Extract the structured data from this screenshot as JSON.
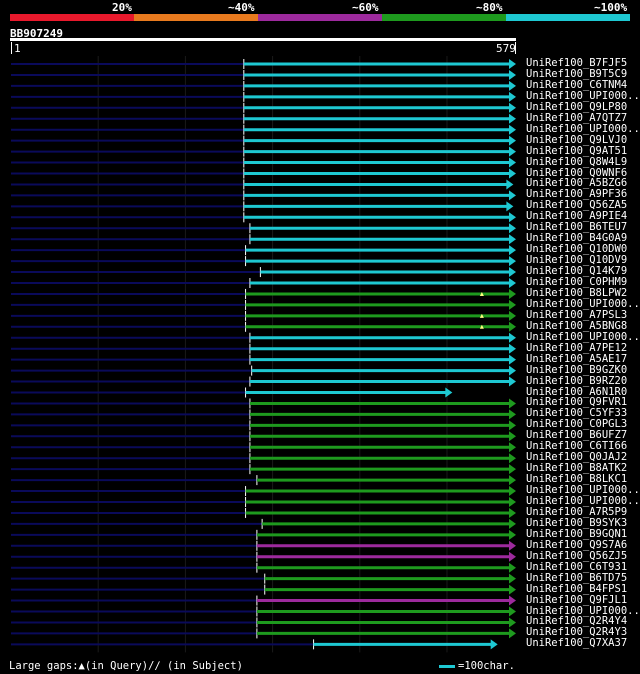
{
  "header": {
    "percent_labels": [
      "20%",
      "~40%",
      "~60%",
      "~80%",
      "~100%"
    ],
    "legend_colors": [
      "#e8192c",
      "#e87a1e",
      "#9d2a9d",
      "#1e9a1e",
      "#1ec8d2"
    ]
  },
  "query": {
    "title": "BB907249",
    "start_label": "1",
    "end_label": "579"
  },
  "colors": {
    "cyan": "#1ec8d2",
    "green": "#1e9a1e",
    "purple": "#9d2a9d",
    "navy": "#0a0a5a",
    "grid": "#1a1a1a",
    "gap_marker": "#ffff80"
  },
  "hits": [
    {
      "label": "UniRef100_B7FJF5",
      "color": "cyan",
      "start": 268,
      "end": 579
    },
    {
      "label": "UniRef100_B9T5C9",
      "color": "cyan",
      "start": 268,
      "end": 579
    },
    {
      "label": "UniRef100_C6TNM4",
      "color": "cyan",
      "start": 268,
      "end": 579
    },
    {
      "label": "UniRef100_UPI000..",
      "color": "cyan",
      "start": 268,
      "end": 579
    },
    {
      "label": "UniRef100_Q9LP80",
      "color": "cyan",
      "start": 268,
      "end": 579
    },
    {
      "label": "UniRef100_A7QTZ7",
      "color": "cyan",
      "start": 268,
      "end": 579
    },
    {
      "label": "UniRef100_UPI000..",
      "color": "cyan",
      "start": 268,
      "end": 579
    },
    {
      "label": "UniRef100_Q9LVJ0",
      "color": "cyan",
      "start": 268,
      "end": 579
    },
    {
      "label": "UniRef100_Q9AT51",
      "color": "cyan",
      "start": 268,
      "end": 579
    },
    {
      "label": "UniRef100_Q8W4L9",
      "color": "cyan",
      "start": 268,
      "end": 579
    },
    {
      "label": "UniRef100_Q0WNF6",
      "color": "cyan",
      "start": 268,
      "end": 579
    },
    {
      "label": "UniRef100_A5BZG6",
      "color": "cyan",
      "start": 268,
      "end": 576
    },
    {
      "label": "UniRef100_A9PF36",
      "color": "cyan",
      "start": 268,
      "end": 579
    },
    {
      "label": "UniRef100_Q56ZA5",
      "color": "cyan",
      "start": 268,
      "end": 576
    },
    {
      "label": "UniRef100_A9PIE4",
      "color": "cyan",
      "start": 268,
      "end": 579
    },
    {
      "label": "UniRef100_B6TEU7",
      "color": "cyan",
      "start": 275,
      "end": 579
    },
    {
      "label": "UniRef100_B4G0A9",
      "color": "cyan",
      "start": 275,
      "end": 579
    },
    {
      "label": "UniRef100_Q10DW0",
      "color": "cyan",
      "start": 270,
      "end": 579
    },
    {
      "label": "UniRef100_Q10DV9",
      "color": "cyan",
      "start": 270,
      "end": 579
    },
    {
      "label": "UniRef100_Q14K79",
      "color": "cyan",
      "start": 287,
      "end": 579
    },
    {
      "label": "UniRef100_C0PHM9",
      "color": "cyan",
      "start": 275,
      "end": 579
    },
    {
      "label": "UniRef100_B8LPW2",
      "color": "green",
      "start": 270,
      "end": 579,
      "gap": 541
    },
    {
      "label": "UniRef100_UPI000..",
      "color": "green",
      "start": 270,
      "end": 579
    },
    {
      "label": "UniRef100_A7PSL3",
      "color": "green",
      "start": 270,
      "end": 579,
      "gap": 541
    },
    {
      "label": "UniRef100_A5BNG8",
      "color": "green",
      "start": 270,
      "end": 579,
      "gap": 541
    },
    {
      "label": "UniRef100_UPI000..",
      "color": "cyan",
      "start": 275,
      "end": 579
    },
    {
      "label": "UniRef100_A7PE12",
      "color": "cyan",
      "start": 275,
      "end": 579
    },
    {
      "label": "UniRef100_A5AE17",
      "color": "cyan",
      "start": 275,
      "end": 579
    },
    {
      "label": "UniRef100_B9GZK0",
      "color": "cyan",
      "start": 277,
      "end": 579
    },
    {
      "label": "UniRef100_B9RZ20",
      "color": "cyan",
      "start": 275,
      "end": 579
    },
    {
      "label": "UniRef100_A6N1R0",
      "color": "cyan",
      "start": 270,
      "end": 506
    },
    {
      "label": "UniRef100_Q9FVR1",
      "color": "green",
      "start": 275,
      "end": 579
    },
    {
      "label": "UniRef100_C5YF33",
      "color": "green",
      "start": 275,
      "end": 579
    },
    {
      "label": "UniRef100_C0PGL3",
      "color": "green",
      "start": 275,
      "end": 579
    },
    {
      "label": "UniRef100_B6UFZ7",
      "color": "green",
      "start": 275,
      "end": 579
    },
    {
      "label": "UniRef100_C6TI66",
      "color": "green",
      "start": 275,
      "end": 579
    },
    {
      "label": "UniRef100_Q0JAJ2",
      "color": "green",
      "start": 275,
      "end": 579
    },
    {
      "label": "UniRef100_B8ATK2",
      "color": "green",
      "start": 275,
      "end": 579
    },
    {
      "label": "UniRef100_B8LKC1",
      "color": "green",
      "start": 283,
      "end": 579
    },
    {
      "label": "UniRef100_UPI000..",
      "color": "green",
      "start": 270,
      "end": 579
    },
    {
      "label": "UniRef100_UPI000..",
      "color": "green",
      "start": 270,
      "end": 579
    },
    {
      "label": "UniRef100_A7R5P9",
      "color": "green",
      "start": 270,
      "end": 579
    },
    {
      "label": "UniRef100_B9SYK3",
      "color": "green",
      "start": 289,
      "end": 579
    },
    {
      "label": "UniRef100_B9GQN1",
      "color": "green",
      "start": 283,
      "end": 579
    },
    {
      "label": "UniRef100_Q9S7A6",
      "color": "purple",
      "start": 283,
      "end": 579
    },
    {
      "label": "UniRef100_Q56ZJ5",
      "color": "purple",
      "start": 283,
      "end": 579
    },
    {
      "label": "UniRef100_C6T931",
      "color": "green",
      "start": 283,
      "end": 579
    },
    {
      "label": "UniRef100_B6TD75",
      "color": "green",
      "start": 292,
      "end": 579
    },
    {
      "label": "UniRef100_B4FPS1",
      "color": "green",
      "start": 292,
      "end": 579
    },
    {
      "label": "UniRef100_Q9FJL1",
      "color": "purple",
      "start": 283,
      "end": 579
    },
    {
      "label": "UniRef100_UPI000..",
      "color": "green",
      "start": 283,
      "end": 579
    },
    {
      "label": "UniRef100_Q2R4Y4",
      "color": "green",
      "start": 283,
      "end": 579
    },
    {
      "label": "UniRef100_Q2R4Y3",
      "color": "green",
      "start": 283,
      "end": 579
    },
    {
      "label": "UniRef100_Q7XA37",
      "color": "cyan",
      "start": 348,
      "end": 558
    }
  ],
  "footer": {
    "gaps_text": "Large gaps:▲(in Query)/∕ (in Subject)",
    "scale_text": "=100char."
  }
}
